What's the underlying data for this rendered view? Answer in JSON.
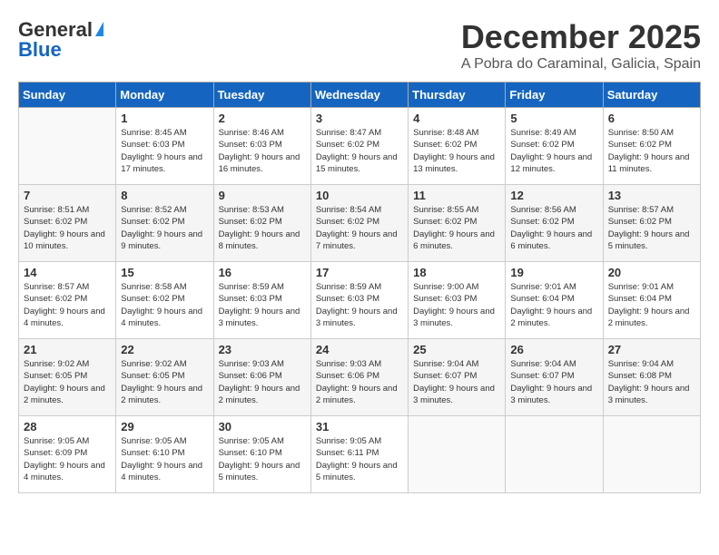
{
  "header": {
    "logo_general": "General",
    "logo_blue": "Blue",
    "month": "December 2025",
    "location": "A Pobra do Caraminal, Galicia, Spain"
  },
  "days_of_week": [
    "Sunday",
    "Monday",
    "Tuesday",
    "Wednesday",
    "Thursday",
    "Friday",
    "Saturday"
  ],
  "weeks": [
    [
      {
        "day": "",
        "sunrise": "",
        "sunset": "",
        "daylight": ""
      },
      {
        "day": "1",
        "sunrise": "Sunrise: 8:45 AM",
        "sunset": "Sunset: 6:03 PM",
        "daylight": "Daylight: 9 hours and 17 minutes."
      },
      {
        "day": "2",
        "sunrise": "Sunrise: 8:46 AM",
        "sunset": "Sunset: 6:03 PM",
        "daylight": "Daylight: 9 hours and 16 minutes."
      },
      {
        "day": "3",
        "sunrise": "Sunrise: 8:47 AM",
        "sunset": "Sunset: 6:02 PM",
        "daylight": "Daylight: 9 hours and 15 minutes."
      },
      {
        "day": "4",
        "sunrise": "Sunrise: 8:48 AM",
        "sunset": "Sunset: 6:02 PM",
        "daylight": "Daylight: 9 hours and 13 minutes."
      },
      {
        "day": "5",
        "sunrise": "Sunrise: 8:49 AM",
        "sunset": "Sunset: 6:02 PM",
        "daylight": "Daylight: 9 hours and 12 minutes."
      },
      {
        "day": "6",
        "sunrise": "Sunrise: 8:50 AM",
        "sunset": "Sunset: 6:02 PM",
        "daylight": "Daylight: 9 hours and 11 minutes."
      }
    ],
    [
      {
        "day": "7",
        "sunrise": "Sunrise: 8:51 AM",
        "sunset": "Sunset: 6:02 PM",
        "daylight": "Daylight: 9 hours and 10 minutes."
      },
      {
        "day": "8",
        "sunrise": "Sunrise: 8:52 AM",
        "sunset": "Sunset: 6:02 PM",
        "daylight": "Daylight: 9 hours and 9 minutes."
      },
      {
        "day": "9",
        "sunrise": "Sunrise: 8:53 AM",
        "sunset": "Sunset: 6:02 PM",
        "daylight": "Daylight: 9 hours and 8 minutes."
      },
      {
        "day": "10",
        "sunrise": "Sunrise: 8:54 AM",
        "sunset": "Sunset: 6:02 PM",
        "daylight": "Daylight: 9 hours and 7 minutes."
      },
      {
        "day": "11",
        "sunrise": "Sunrise: 8:55 AM",
        "sunset": "Sunset: 6:02 PM",
        "daylight": "Daylight: 9 hours and 6 minutes."
      },
      {
        "day": "12",
        "sunrise": "Sunrise: 8:56 AM",
        "sunset": "Sunset: 6:02 PM",
        "daylight": "Daylight: 9 hours and 6 minutes."
      },
      {
        "day": "13",
        "sunrise": "Sunrise: 8:57 AM",
        "sunset": "Sunset: 6:02 PM",
        "daylight": "Daylight: 9 hours and 5 minutes."
      }
    ],
    [
      {
        "day": "14",
        "sunrise": "Sunrise: 8:57 AM",
        "sunset": "Sunset: 6:02 PM",
        "daylight": "Daylight: 9 hours and 4 minutes."
      },
      {
        "day": "15",
        "sunrise": "Sunrise: 8:58 AM",
        "sunset": "Sunset: 6:02 PM",
        "daylight": "Daylight: 9 hours and 4 minutes."
      },
      {
        "day": "16",
        "sunrise": "Sunrise: 8:59 AM",
        "sunset": "Sunset: 6:03 PM",
        "daylight": "Daylight: 9 hours and 3 minutes."
      },
      {
        "day": "17",
        "sunrise": "Sunrise: 8:59 AM",
        "sunset": "Sunset: 6:03 PM",
        "daylight": "Daylight: 9 hours and 3 minutes."
      },
      {
        "day": "18",
        "sunrise": "Sunrise: 9:00 AM",
        "sunset": "Sunset: 6:03 PM",
        "daylight": "Daylight: 9 hours and 3 minutes."
      },
      {
        "day": "19",
        "sunrise": "Sunrise: 9:01 AM",
        "sunset": "Sunset: 6:04 PM",
        "daylight": "Daylight: 9 hours and 2 minutes."
      },
      {
        "day": "20",
        "sunrise": "Sunrise: 9:01 AM",
        "sunset": "Sunset: 6:04 PM",
        "daylight": "Daylight: 9 hours and 2 minutes."
      }
    ],
    [
      {
        "day": "21",
        "sunrise": "Sunrise: 9:02 AM",
        "sunset": "Sunset: 6:05 PM",
        "daylight": "Daylight: 9 hours and 2 minutes."
      },
      {
        "day": "22",
        "sunrise": "Sunrise: 9:02 AM",
        "sunset": "Sunset: 6:05 PM",
        "daylight": "Daylight: 9 hours and 2 minutes."
      },
      {
        "day": "23",
        "sunrise": "Sunrise: 9:03 AM",
        "sunset": "Sunset: 6:06 PM",
        "daylight": "Daylight: 9 hours and 2 minutes."
      },
      {
        "day": "24",
        "sunrise": "Sunrise: 9:03 AM",
        "sunset": "Sunset: 6:06 PM",
        "daylight": "Daylight: 9 hours and 2 minutes."
      },
      {
        "day": "25",
        "sunrise": "Sunrise: 9:04 AM",
        "sunset": "Sunset: 6:07 PM",
        "daylight": "Daylight: 9 hours and 3 minutes."
      },
      {
        "day": "26",
        "sunrise": "Sunrise: 9:04 AM",
        "sunset": "Sunset: 6:07 PM",
        "daylight": "Daylight: 9 hours and 3 minutes."
      },
      {
        "day": "27",
        "sunrise": "Sunrise: 9:04 AM",
        "sunset": "Sunset: 6:08 PM",
        "daylight": "Daylight: 9 hours and 3 minutes."
      }
    ],
    [
      {
        "day": "28",
        "sunrise": "Sunrise: 9:05 AM",
        "sunset": "Sunset: 6:09 PM",
        "daylight": "Daylight: 9 hours and 4 minutes."
      },
      {
        "day": "29",
        "sunrise": "Sunrise: 9:05 AM",
        "sunset": "Sunset: 6:10 PM",
        "daylight": "Daylight: 9 hours and 4 minutes."
      },
      {
        "day": "30",
        "sunrise": "Sunrise: 9:05 AM",
        "sunset": "Sunset: 6:10 PM",
        "daylight": "Daylight: 9 hours and 5 minutes."
      },
      {
        "day": "31",
        "sunrise": "Sunrise: 9:05 AM",
        "sunset": "Sunset: 6:11 PM",
        "daylight": "Daylight: 9 hours and 5 minutes."
      },
      {
        "day": "",
        "sunrise": "",
        "sunset": "",
        "daylight": ""
      },
      {
        "day": "",
        "sunrise": "",
        "sunset": "",
        "daylight": ""
      },
      {
        "day": "",
        "sunrise": "",
        "sunset": "",
        "daylight": ""
      }
    ]
  ]
}
